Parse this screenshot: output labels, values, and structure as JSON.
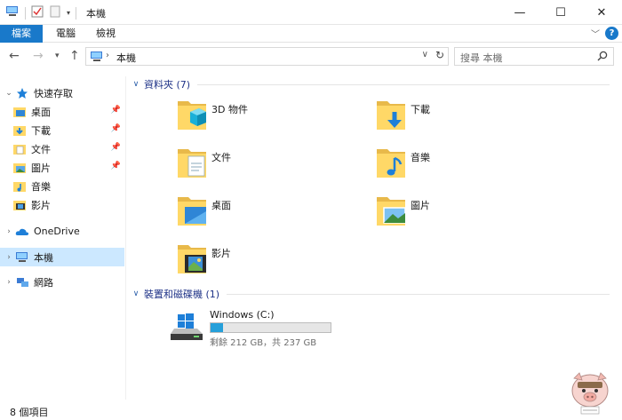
{
  "window": {
    "title": "本機",
    "minimize": "—",
    "maximize": "☐",
    "close": "✕"
  },
  "ribbon": {
    "tabs": [
      "檔案",
      "電腦",
      "檢視"
    ],
    "help": "?"
  },
  "navbar": {
    "address": "本機",
    "search_placeholder": "搜尋 本機"
  },
  "sidebar": {
    "quick_access": "快速存取",
    "quick_items": [
      "桌面",
      "下載",
      "文件",
      "圖片",
      "音樂",
      "影片"
    ],
    "onedrive": "OneDrive",
    "this_pc": "本機",
    "network": "網路"
  },
  "folders_group": "資料夾 (7)",
  "folders": [
    "3D 物件",
    "下載",
    "文件",
    "音樂",
    "桌面",
    "圖片",
    "影片"
  ],
  "devices_group": "裝置和磁碟機 (1)",
  "drive": {
    "name": "Windows (C:)",
    "free": "剩餘 212 GB，共 237 GB",
    "used_fraction": 0.106
  },
  "status": "8 個項目",
  "colors": {
    "accent": "#1979ca",
    "selection": "#cce8ff",
    "folder": "#ffd867",
    "group_text": "#1e3287"
  }
}
